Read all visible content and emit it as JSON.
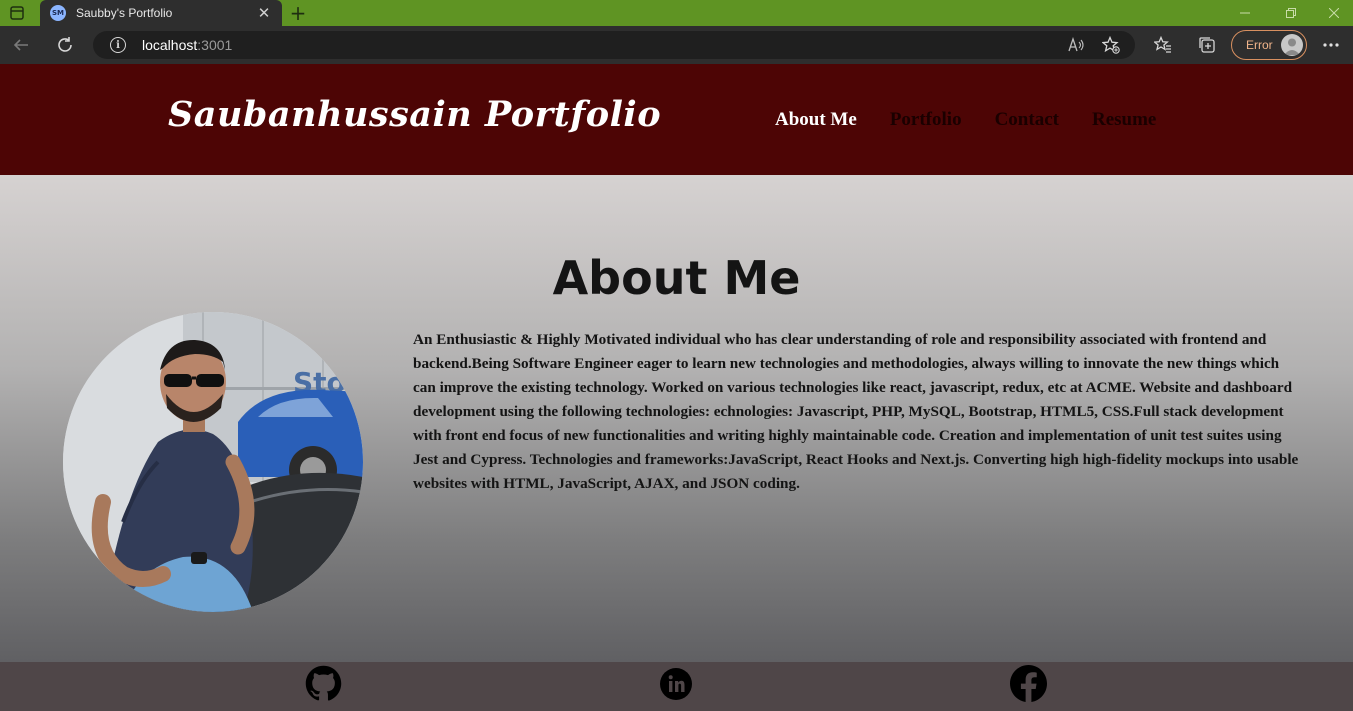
{
  "browser": {
    "tab_title": "Saubby's Portfolio",
    "tab_favicon_text": "SM",
    "tab_close": "✕",
    "new_tab": "+",
    "address_host": "localhost",
    "address_port": ":3001",
    "error_label": "Error",
    "accent_color": "#5f9423"
  },
  "header": {
    "brand": "Saubanhussain Portfolio",
    "nav": [
      {
        "label": "About Me",
        "active": true
      },
      {
        "label": "Portfolio",
        "active": false
      },
      {
        "label": "Contact",
        "active": false
      },
      {
        "label": "Resume",
        "active": false
      }
    ],
    "background": "#4d0505"
  },
  "about": {
    "title": "About Me",
    "text": "An Enthusiastic & Highly Motivated individual who has clear understanding of role and responsibility associated with frontend and backend.Being Software Engineer eager to learn new technologies and methodologies, always willing to innovate the new things which can improve the existing technology. Worked on various technologies like react, javascript, redux, etc at ACME. Website and dashboard development using the following technologies: echnologies: Javascript, PHP, MySQL, Bootstrap, HTML5, CSS.Full stack development with front end focus of new functionalities and writing highly maintainable code. Creation and implementation of unit test suites using Jest and Cypress. Technologies and frameworks:JavaScript, React Hooks and Next.js. Converting high high-fidelity mockups into usable websites with HTML, JavaScript, AJAX, and JSON coding."
  },
  "footer": {
    "icons": [
      "github-icon",
      "linkedin-icon",
      "facebook-icon"
    ]
  }
}
